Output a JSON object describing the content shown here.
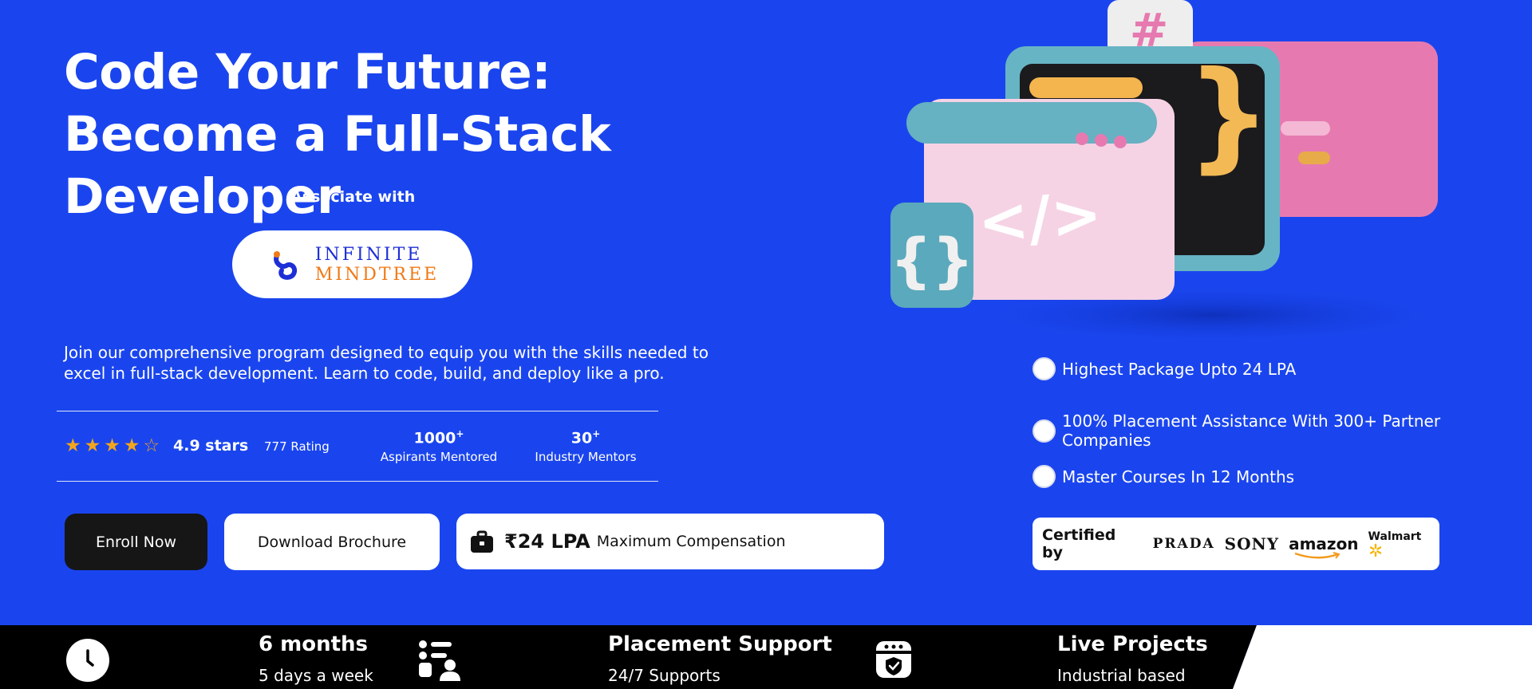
{
  "hero": {
    "title": "Code Your Future: Become a Full-Stack Developer",
    "associate_label": "Associate with",
    "partner": {
      "line1": "INFINITE",
      "line2": "MINDTREE",
      "logo_icon": "infinity-swirl-icon"
    },
    "description": "Join our comprehensive program designed to equip you with the skills needed to excel in full-stack development. Learn to code, build, and deploy like a pro."
  },
  "stats": {
    "stars_display": "★★★★☆",
    "rating_value": "4.9 stars",
    "rating_count": "777 Rating",
    "items": [
      {
        "value": "1000",
        "suffix": "+",
        "label": "Aspirants Mentored"
      },
      {
        "value": "30",
        "suffix": "+",
        "label": "Industry Mentors"
      }
    ]
  },
  "actions": {
    "enroll_label": "Enroll Now",
    "brochure_label": "Download Brochure",
    "compensation_amount": "₹24 LPA",
    "compensation_label": "Maximum Compensation",
    "compensation_icon": "briefcase-icon"
  },
  "features": [
    "Highest Package Upto 24 LPA",
    "100% Placement Assistance With 300+ Partner Companies",
    "Master Courses In 12 Months"
  ],
  "certification": {
    "label": "Certified by",
    "brands": [
      "PRADA",
      "SONY",
      "amazon",
      "Walmart"
    ]
  },
  "info_bar": [
    {
      "icon": "clock-icon",
      "title": "6 months",
      "subtitle": "5 days a week"
    },
    {
      "icon": "placement-people-icon",
      "title": "Placement Support",
      "subtitle": "24/7 Supports"
    },
    {
      "icon": "shield-badge-icon",
      "title": "Live Projects",
      "subtitle": "Industrial based"
    }
  ],
  "colors": {
    "background": "#1a45ee",
    "star": "#f3a51b",
    "dark_button": "#161616",
    "partner_blue": "#1d2fd6",
    "partner_orange": "#f07a17"
  }
}
